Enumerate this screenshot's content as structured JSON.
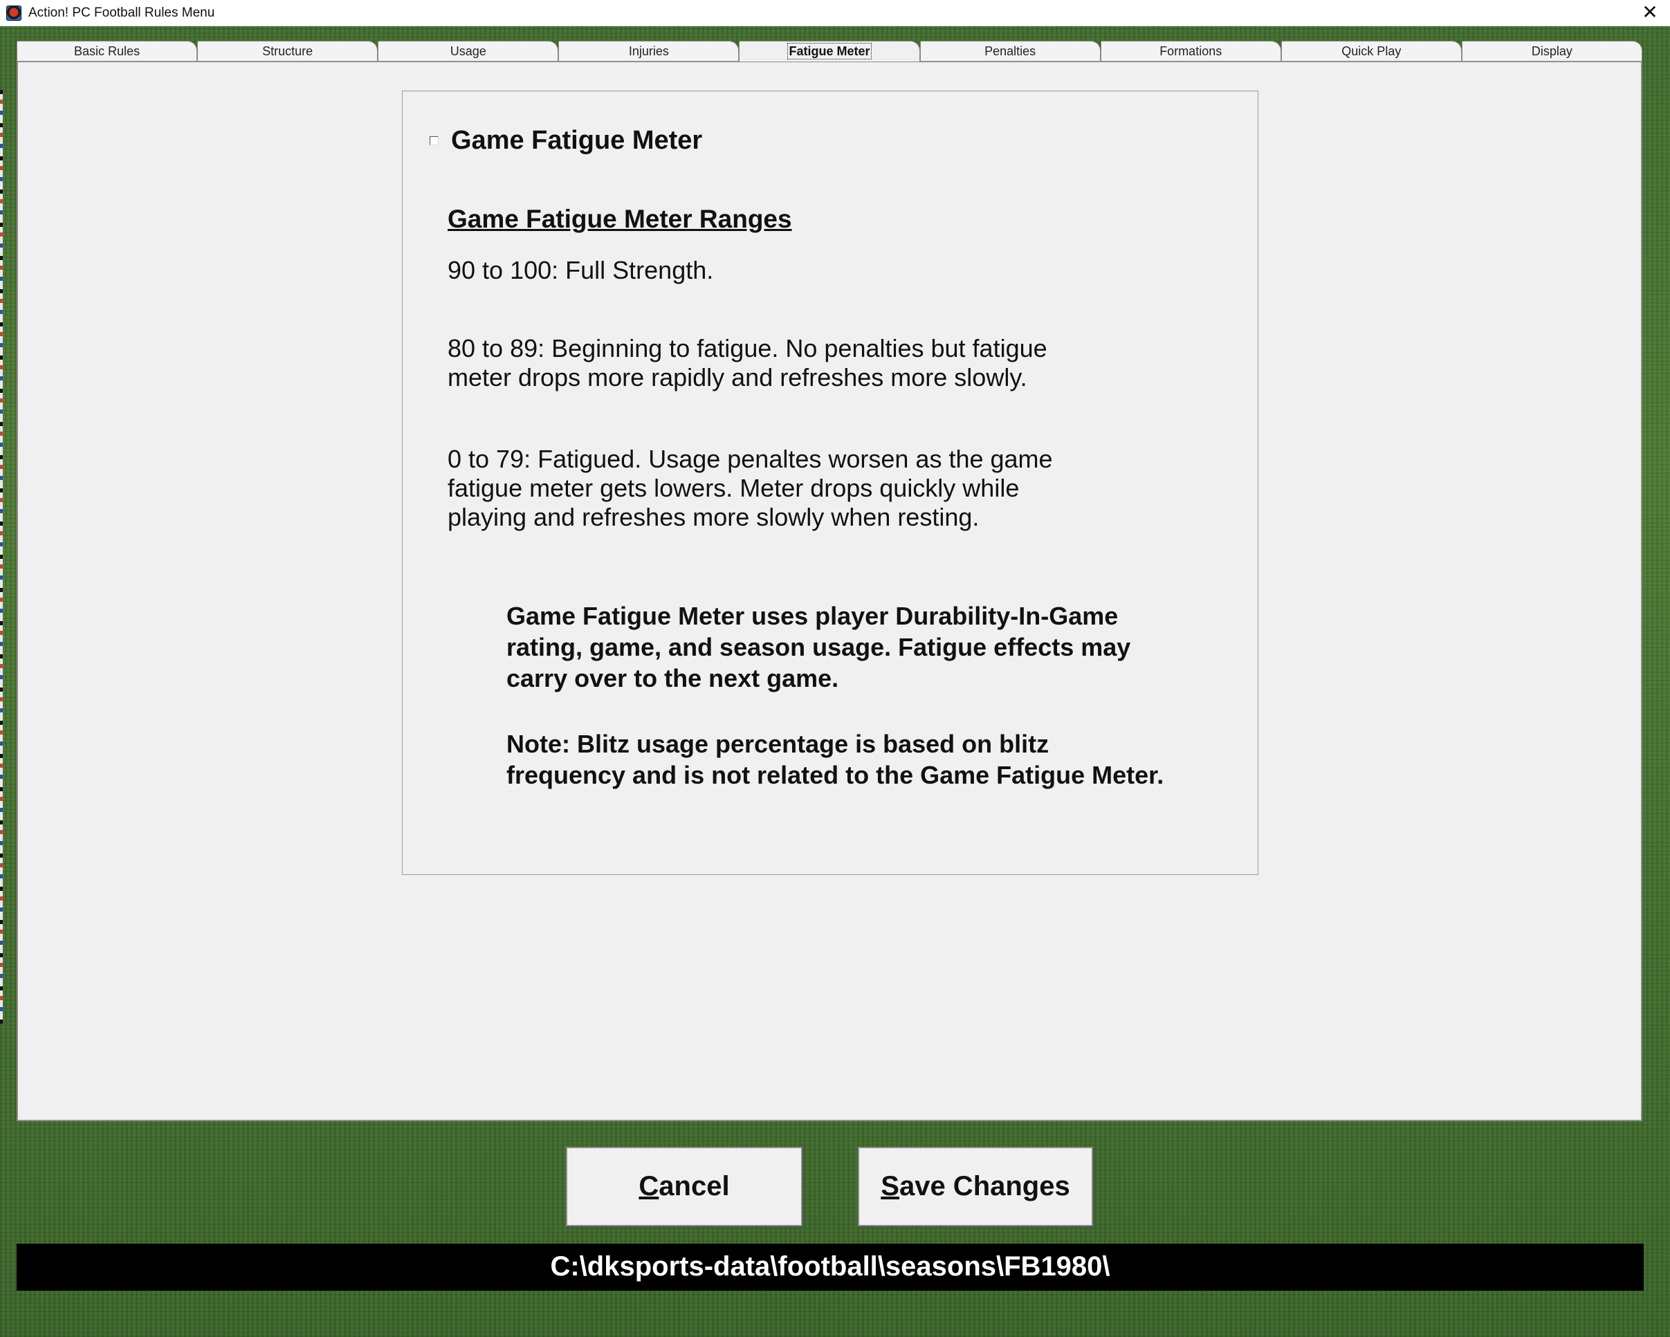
{
  "window": {
    "title": "Action! PC Football Rules Menu",
    "close_glyph": "✕"
  },
  "tabs": [
    {
      "label": "Basic Rules"
    },
    {
      "label": "Structure"
    },
    {
      "label": "Usage"
    },
    {
      "label": "Injuries"
    },
    {
      "label": "Fatigue Meter",
      "active": true
    },
    {
      "label": "Penalties"
    },
    {
      "label": "Formations"
    },
    {
      "label": "Quick Play"
    },
    {
      "label": "Display"
    }
  ],
  "fatigue": {
    "checkbox_label": "Game Fatigue Meter",
    "checkbox_checked": false,
    "ranges_heading": "Game Fatigue Meter Ranges",
    "range_1": "90 to 100: Full Strength.",
    "range_2": "80 to 89: Beginning to fatigue. No penalties but fatigue\nmeter drops more rapidly and refreshes more slowly.",
    "range_3": "0 to 79: Fatigued. Usage penaltes worsen as the game\nfatigue meter gets lowers. Meter drops quickly while\nplaying and refreshes more slowly when resting.",
    "note_1": "Game Fatigue Meter uses player Durability-In-Game\nrating, game, and season usage.  Fatigue effects may\ncarry over to the next game.",
    "note_2": "Note: Blitz usage percentage is based on blitz\nfrequency and is not related to the Game Fatigue Meter."
  },
  "buttons": {
    "cancel_mnemonic": "C",
    "cancel_rest": "ancel",
    "save_mnemonic": "S",
    "save_rest": "ave Changes"
  },
  "status": {
    "path": "C:\\dksports-data\\football\\seasons\\FB1980\\"
  }
}
